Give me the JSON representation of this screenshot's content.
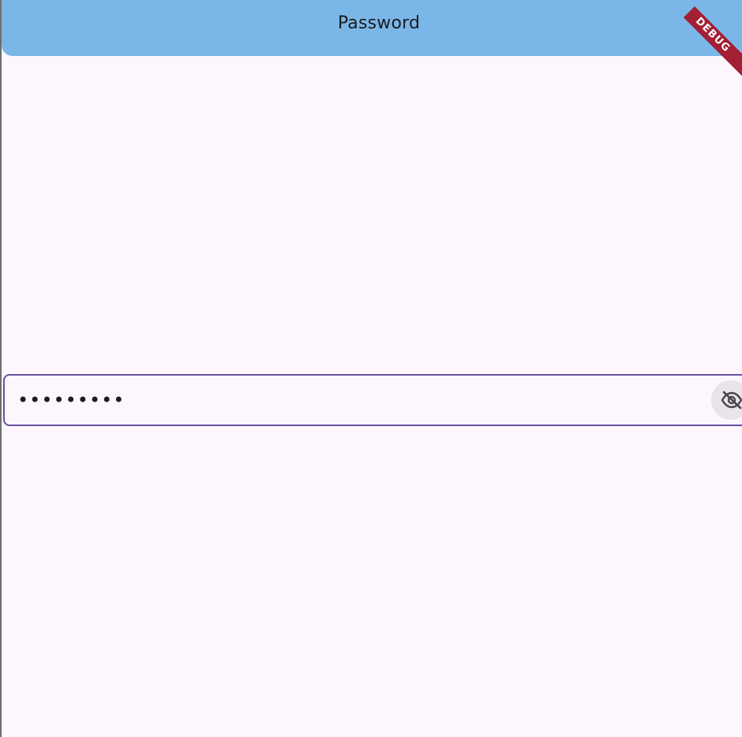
{
  "app_bar": {
    "title": "Password",
    "background": "#7ab7e8"
  },
  "password_field": {
    "masked_value": "•••••••••",
    "border_color": "#6750a4",
    "toggle_icon": "visibility-off-icon",
    "obscured": true
  },
  "debug_banner": {
    "label": "DEBUG",
    "color": "#a31f34"
  },
  "theme": {
    "background": "#fdf7fd",
    "text": "#1c1b1f"
  }
}
